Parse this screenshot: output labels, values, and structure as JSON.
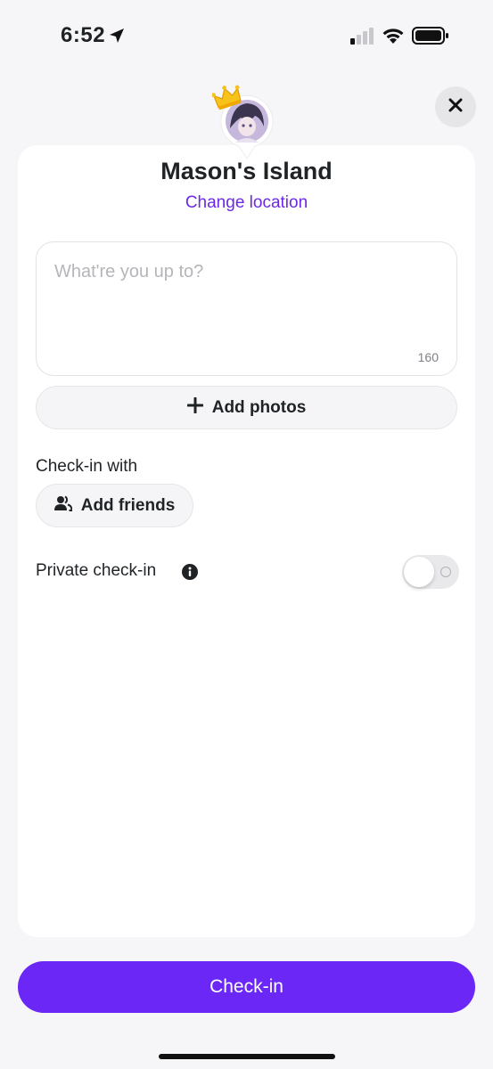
{
  "status_bar": {
    "time": "6:52"
  },
  "header": {
    "place_title": "Mason's Island",
    "change_location_label": "Change location"
  },
  "post": {
    "placeholder": "What're you up to?",
    "value": "",
    "char_count": "160"
  },
  "actions": {
    "add_photos_label": "Add photos",
    "checkin_with_label": "Check-in with",
    "add_friends_label": "Add friends",
    "private_checkin_label": "Private check-in",
    "private_checkin_enabled": false
  },
  "footer": {
    "checkin_button_label": "Check-in"
  },
  "icons": {
    "close": "close-icon",
    "add": "plus-icon",
    "friends": "people-icon",
    "info": "info-icon",
    "location": "location-arrow-icon",
    "crown": "crown-icon"
  },
  "colors": {
    "accent": "#6a27f5",
    "link": "#6a2ae3",
    "background": "#f6f6f8",
    "card": "#ffffff"
  }
}
